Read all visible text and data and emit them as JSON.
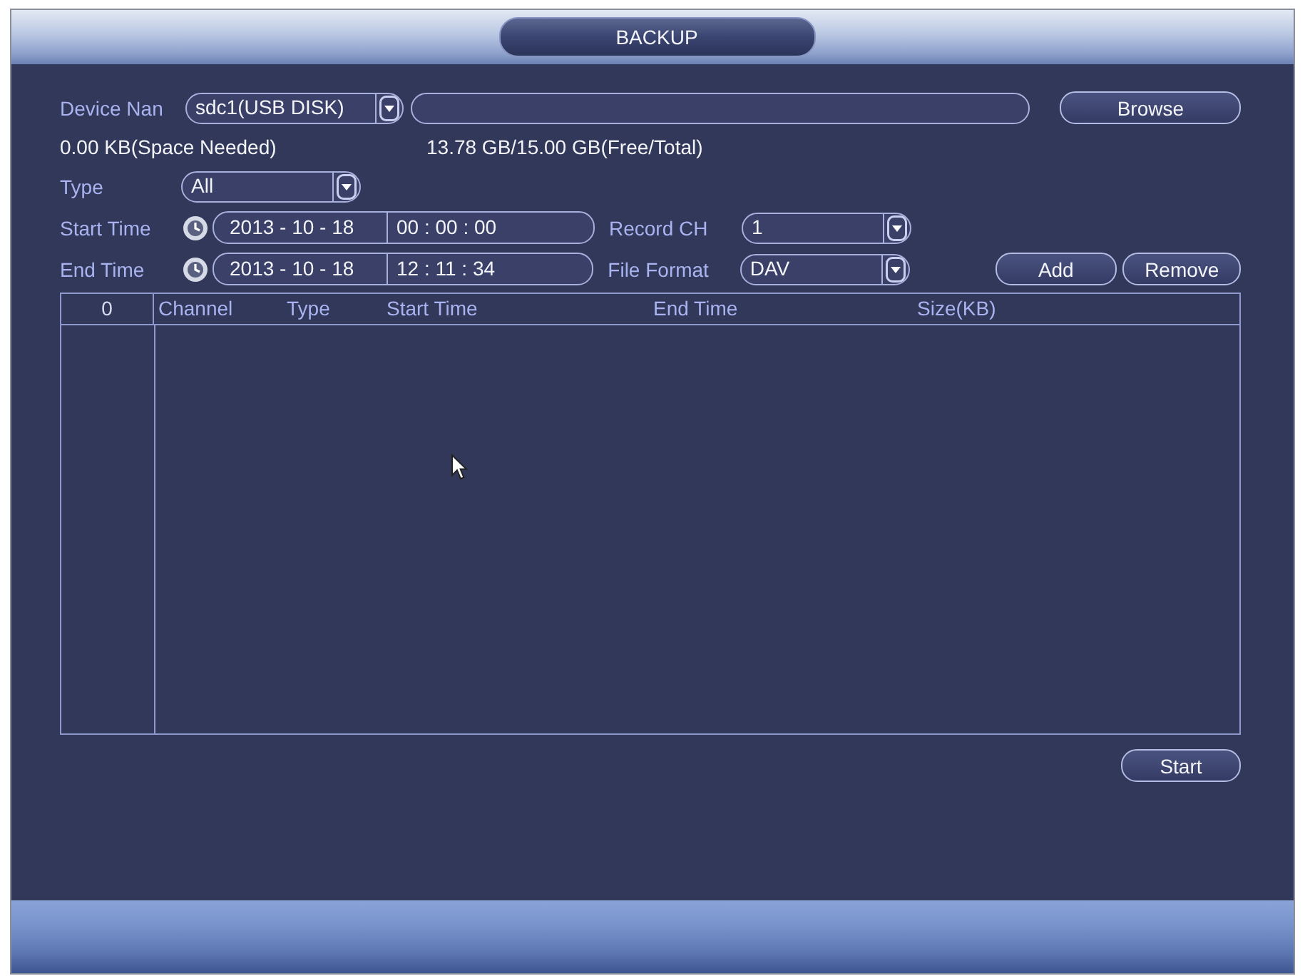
{
  "window": {
    "title": "BACKUP"
  },
  "device": {
    "label": "Device Nan",
    "value": "sdc1(USB DISK)",
    "browse_button": "Browse"
  },
  "space": {
    "needed": "0.00 KB(Space Needed)",
    "free_total": "13.78 GB/15.00 GB(Free/Total)"
  },
  "type": {
    "label": "Type",
    "value": "All"
  },
  "start_time": {
    "label": "Start Time",
    "date": "2013 - 10 - 18",
    "time": "00 : 00 : 00"
  },
  "end_time": {
    "label": "End Time",
    "date": "2013 - 10 - 18",
    "time": "12 : 11 : 34"
  },
  "record_ch": {
    "label": "Record CH",
    "value": "1"
  },
  "file_format": {
    "label": "File Format",
    "value": "DAV"
  },
  "add_button": "Add",
  "remove_button": "Remove",
  "table": {
    "columns": [
      "0",
      "Channel",
      "Type",
      "Start Time",
      "End Time",
      "Size(KB)"
    ]
  },
  "start_button": "Start"
}
